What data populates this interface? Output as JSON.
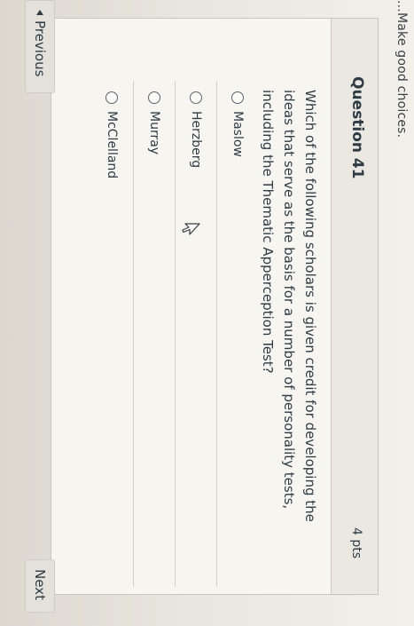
{
  "banner": {
    "text": "...Make good choices."
  },
  "question": {
    "title": "Question 41",
    "points": "4 pts",
    "text": "Which of the following scholars is given credit for developing the ideas that serve as the basis for a number of personality tests, including the Thematic Apperception Test?"
  },
  "answers": [
    {
      "label": "Maslow"
    },
    {
      "label": "Herzberg"
    },
    {
      "label": "Murray"
    },
    {
      "label": "McClelland"
    }
  ],
  "nav": {
    "previous_label": "Previous",
    "next_label": "Next"
  },
  "icons": {
    "cursor": "mouse-pointer-icon",
    "ribbon": "ribbon-arrow-icon"
  }
}
